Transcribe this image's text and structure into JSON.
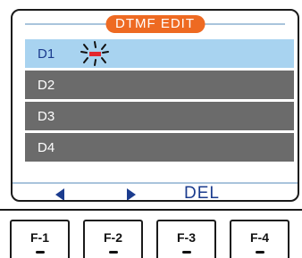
{
  "screen": {
    "title": "DTMF EDIT",
    "rows": [
      {
        "label": "D1",
        "selected": true
      },
      {
        "label": "D2",
        "selected": false
      },
      {
        "label": "D3",
        "selected": false
      },
      {
        "label": "D4",
        "selected": false
      }
    ],
    "cursor_icon": "blinking-cursor-icon",
    "softkeys": {
      "left_icon": "left-arrow-icon",
      "right_icon": "right-arrow-icon",
      "del_label": "DEL"
    }
  },
  "function_keys": [
    {
      "label": "F-1"
    },
    {
      "label": "F-2"
    },
    {
      "label": "F-3"
    },
    {
      "label": "F-4"
    }
  ],
  "colors": {
    "title_pill": "#ee6a22",
    "selected_row": "#a8d3f0",
    "row": "#6b6b6b",
    "softkey_text": "#1b3c8e",
    "cursor": "#e3262d"
  }
}
